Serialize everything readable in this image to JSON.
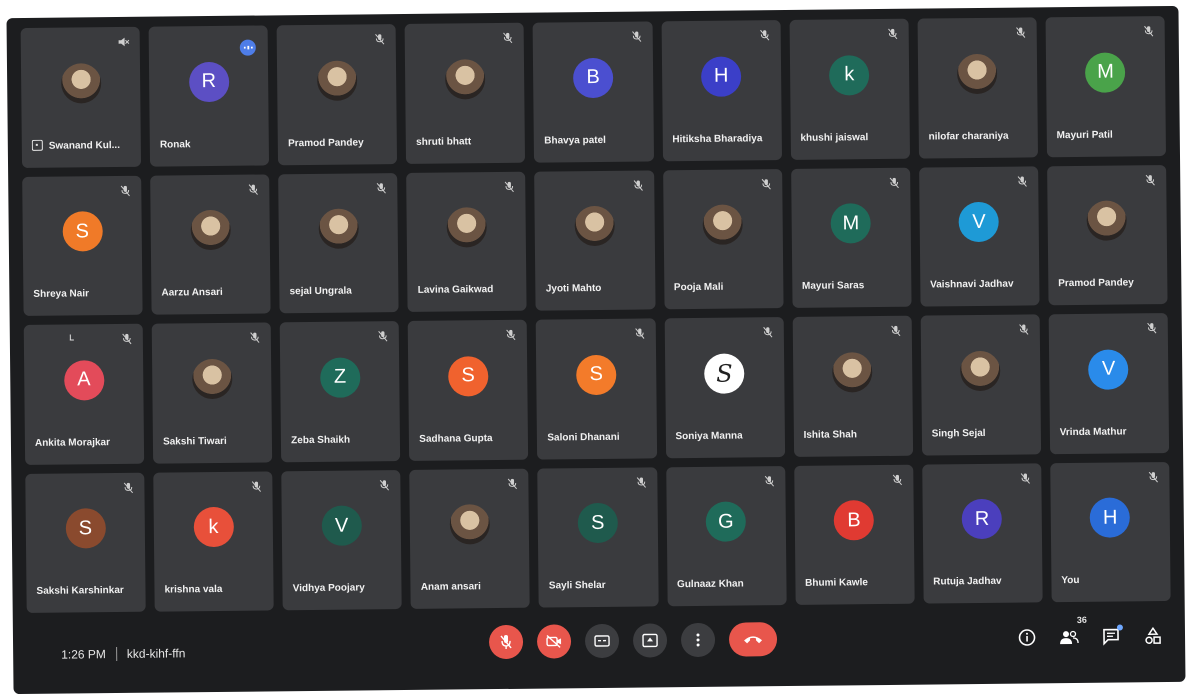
{
  "meeting": {
    "time": "1:26 PM",
    "code": "kkd-kihf-ffn",
    "participants_count": "36"
  },
  "colors": {
    "tile_bg": "#3a3b3e",
    "screen_bg": "#1c1d1f",
    "control_red": "#e8564c",
    "control_gray": "#3c3d40"
  },
  "participants": [
    {
      "name": "Swanand Kul...",
      "avatar": "photo",
      "initial": "",
      "color": "",
      "mic": "speaker-muted",
      "pinned": true
    },
    {
      "name": "Ronak",
      "avatar": "letter",
      "initial": "R",
      "color": "#5c4fc4",
      "mic": "badge"
    },
    {
      "name": "Pramod Pandey",
      "avatar": "photo",
      "initial": "",
      "color": "",
      "mic": "muted"
    },
    {
      "name": "shruti bhatt",
      "avatar": "photo",
      "initial": "",
      "color": "",
      "mic": "muted"
    },
    {
      "name": "Bhavya patel",
      "avatar": "letter",
      "initial": "B",
      "color": "#4b4fd0",
      "mic": "muted"
    },
    {
      "name": "Hitiksha Bharadiya",
      "avatar": "letter",
      "initial": "H",
      "color": "#3b3fc8",
      "mic": "muted"
    },
    {
      "name": "khushi jaiswal",
      "avatar": "letter",
      "initial": "k",
      "color": "#1f6b5a",
      "mic": "muted"
    },
    {
      "name": "nilofar charaniya",
      "avatar": "photo",
      "initial": "",
      "color": "",
      "mic": "muted"
    },
    {
      "name": "Mayuri Patil",
      "avatar": "letter",
      "initial": "M",
      "color": "#4aa34a",
      "mic": "muted"
    },
    {
      "name": "Shreya Nair",
      "avatar": "letter",
      "initial": "S",
      "color": "#f07a28",
      "mic": "muted"
    },
    {
      "name": "Aarzu Ansari",
      "avatar": "photo",
      "initial": "",
      "color": "",
      "mic": "muted"
    },
    {
      "name": "sejal Ungrala",
      "avatar": "photo",
      "initial": "",
      "color": "",
      "mic": "muted"
    },
    {
      "name": "Lavina Gaikwad",
      "avatar": "photo",
      "initial": "",
      "color": "",
      "mic": "muted"
    },
    {
      "name": "Jyoti Mahto",
      "avatar": "photo",
      "initial": "",
      "color": "",
      "mic": "muted"
    },
    {
      "name": "Pooja Mali",
      "avatar": "photo",
      "initial": "",
      "color": "",
      "mic": "muted"
    },
    {
      "name": "Mayuri Saras",
      "avatar": "letter",
      "initial": "M",
      "color": "#1f6b5a",
      "mic": "muted"
    },
    {
      "name": "Vaishnavi Jadhav",
      "avatar": "letter",
      "initial": "V",
      "color": "#1e9ad6",
      "mic": "muted"
    },
    {
      "name": "Pramod Pandey",
      "avatar": "photo",
      "initial": "",
      "color": "",
      "mic": "muted"
    },
    {
      "name": "Ankita Morajkar",
      "avatar": "letter",
      "initial": "A",
      "color": "#e34b5a",
      "mic": "muted",
      "corner": true
    },
    {
      "name": "Sakshi Tiwari",
      "avatar": "photo",
      "initial": "",
      "color": "",
      "mic": "muted"
    },
    {
      "name": "Zeba Shaikh",
      "avatar": "letter",
      "initial": "Z",
      "color": "#1f6b5a",
      "mic": "muted"
    },
    {
      "name": "Sadhana Gupta",
      "avatar": "letter",
      "initial": "S",
      "color": "#f0622e",
      "mic": "muted"
    },
    {
      "name": "Saloni Dhanani",
      "avatar": "letter",
      "initial": "S",
      "color": "#f37b2a",
      "mic": "muted"
    },
    {
      "name": "Soniya Manna",
      "avatar": "script",
      "initial": "S",
      "color": "#ffffff",
      "mic": "muted"
    },
    {
      "name": "Ishita Shah",
      "avatar": "photo",
      "initial": "",
      "color": "",
      "mic": "muted"
    },
    {
      "name": "Singh Sejal",
      "avatar": "photo",
      "initial": "",
      "color": "",
      "mic": "muted"
    },
    {
      "name": "Vrinda Mathur",
      "avatar": "letter",
      "initial": "V",
      "color": "#2a8bea",
      "mic": "muted"
    },
    {
      "name": "Sakshi Karshinkar",
      "avatar": "letter",
      "initial": "S",
      "color": "#8a4a2e",
      "mic": "muted"
    },
    {
      "name": "krishna vala",
      "avatar": "letter",
      "initial": "k",
      "color": "#e8503a",
      "mic": "muted"
    },
    {
      "name": "Vidhya Poojary",
      "avatar": "letter",
      "initial": "V",
      "color": "#1f5a4d",
      "mic": "muted"
    },
    {
      "name": "Anam ansari",
      "avatar": "photo",
      "initial": "",
      "color": "",
      "mic": "muted"
    },
    {
      "name": "Sayli Shelar",
      "avatar": "letter",
      "initial": "S",
      "color": "#1f5a4d",
      "mic": "muted"
    },
    {
      "name": "Gulnaaz Khan",
      "avatar": "letter",
      "initial": "G",
      "color": "#1f6b5a",
      "mic": "muted"
    },
    {
      "name": "Bhumi Kawle",
      "avatar": "letter",
      "initial": "B",
      "color": "#e03a32",
      "mic": "muted"
    },
    {
      "name": "Rutuja Jadhav",
      "avatar": "letter",
      "initial": "R",
      "color": "#4b3fbd",
      "mic": "muted"
    },
    {
      "name": "You",
      "avatar": "letter",
      "initial": "H",
      "color": "#2a6cd8",
      "mic": "muted"
    }
  ],
  "controls": {
    "left": [
      {
        "name": "mic-button",
        "icon": "mic-off-icon",
        "style": "red"
      },
      {
        "name": "camera-button",
        "icon": "camera-off-icon",
        "style": "red"
      },
      {
        "name": "captions-button",
        "icon": "captions-icon",
        "style": "gray"
      },
      {
        "name": "present-button",
        "icon": "present-icon",
        "style": "gray"
      },
      {
        "name": "more-options-button",
        "icon": "more-vert-icon",
        "style": "gray"
      },
      {
        "name": "leave-call-button",
        "icon": "hangup-icon",
        "style": "hangup"
      }
    ],
    "right": [
      {
        "name": "meeting-details-button",
        "icon": "info-icon"
      },
      {
        "name": "people-button",
        "icon": "people-icon",
        "badge": true
      },
      {
        "name": "chat-button",
        "icon": "chat-icon",
        "dot": true
      },
      {
        "name": "activities-button",
        "icon": "activities-icon"
      }
    ]
  }
}
